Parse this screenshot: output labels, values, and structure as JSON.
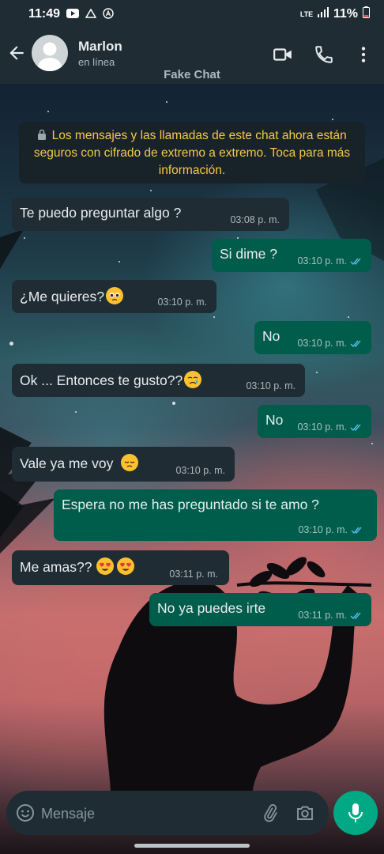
{
  "status_bar": {
    "time": "11:49",
    "network": "LTE",
    "battery": "11%"
  },
  "app_bar": {
    "contact_name": "Marlon",
    "contact_status": "en línea"
  },
  "watermark": "Fake Chat",
  "encryption_notice": "Los mensajes y las llamadas de este chat ahora están seguros con cifrado de extremo a extremo. Toca para más información.",
  "messages": [
    {
      "direction": "in",
      "text": "Te puedo preguntar algo ?",
      "time": "03:08 p. m."
    },
    {
      "direction": "out",
      "text": "Si dime ?",
      "time": "03:10 p. m.",
      "status": "read"
    },
    {
      "direction": "in",
      "text": "¿Me quieres?",
      "time": "03:10 p. m.",
      "emoji": "pleading-face"
    },
    {
      "direction": "out",
      "text": "No",
      "time": "03:10 p. m.",
      "status": "read"
    },
    {
      "direction": "in",
      "text": "Ok ... Entonces te gusto??",
      "time": "03:10 p. m.",
      "emoji": "crying-face"
    },
    {
      "direction": "out",
      "text": "No",
      "time": "03:10 p. m.",
      "status": "read"
    },
    {
      "direction": "in",
      "text": "Vale ya me voy",
      "time": "03:10 p. m.",
      "emoji": "pensive-face"
    },
    {
      "direction": "out",
      "text": "Espera no me has preguntado si te amo ?",
      "time": "03:10 p. m.",
      "status": "read"
    },
    {
      "direction": "in",
      "text": "Me amas??",
      "time": "03:11 p. m.",
      "emoji": "heart-eyes-face-x2"
    },
    {
      "direction": "out",
      "text": "No ya puedes irte",
      "time": "03:11 p. m.",
      "status": "read"
    }
  ],
  "composer": {
    "placeholder": "Mensaje"
  },
  "colors": {
    "header": "#1f2c34",
    "incoming_bubble": "#1f2c34",
    "outgoing_bubble": "#005c4b",
    "notice_text": "#f7c948",
    "read_tick": "#53bdeb",
    "mic_button": "#00a884"
  },
  "icons": [
    "back-arrow-icon",
    "video-call-icon",
    "phone-icon",
    "more-options-icon",
    "lock-icon",
    "emoji-icon",
    "attach-icon",
    "camera-icon",
    "mic-icon",
    "read-receipt-icon"
  ]
}
